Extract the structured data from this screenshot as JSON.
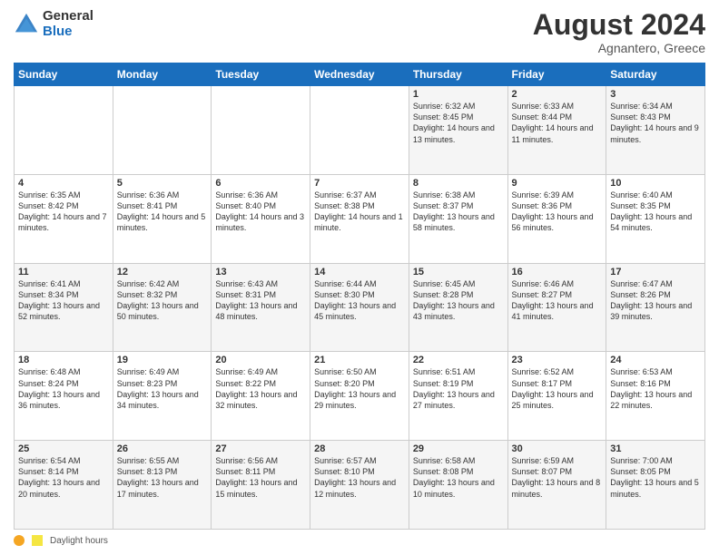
{
  "header": {
    "logo_general": "General",
    "logo_blue": "Blue",
    "month_title": "August 2024",
    "location": "Agnantero, Greece"
  },
  "calendar": {
    "days_of_week": [
      "Sunday",
      "Monday",
      "Tuesday",
      "Wednesday",
      "Thursday",
      "Friday",
      "Saturday"
    ],
    "weeks": [
      [
        {
          "day": "",
          "info": ""
        },
        {
          "day": "",
          "info": ""
        },
        {
          "day": "",
          "info": ""
        },
        {
          "day": "",
          "info": ""
        },
        {
          "day": "1",
          "info": "Sunrise: 6:32 AM\nSunset: 8:45 PM\nDaylight: 14 hours\nand 13 minutes."
        },
        {
          "day": "2",
          "info": "Sunrise: 6:33 AM\nSunset: 8:44 PM\nDaylight: 14 hours\nand 11 minutes."
        },
        {
          "day": "3",
          "info": "Sunrise: 6:34 AM\nSunset: 8:43 PM\nDaylight: 14 hours\nand 9 minutes."
        }
      ],
      [
        {
          "day": "4",
          "info": "Sunrise: 6:35 AM\nSunset: 8:42 PM\nDaylight: 14 hours\nand 7 minutes."
        },
        {
          "day": "5",
          "info": "Sunrise: 6:36 AM\nSunset: 8:41 PM\nDaylight: 14 hours\nand 5 minutes."
        },
        {
          "day": "6",
          "info": "Sunrise: 6:36 AM\nSunset: 8:40 PM\nDaylight: 14 hours\nand 3 minutes."
        },
        {
          "day": "7",
          "info": "Sunrise: 6:37 AM\nSunset: 8:38 PM\nDaylight: 14 hours\nand 1 minute."
        },
        {
          "day": "8",
          "info": "Sunrise: 6:38 AM\nSunset: 8:37 PM\nDaylight: 13 hours\nand 58 minutes."
        },
        {
          "day": "9",
          "info": "Sunrise: 6:39 AM\nSunset: 8:36 PM\nDaylight: 13 hours\nand 56 minutes."
        },
        {
          "day": "10",
          "info": "Sunrise: 6:40 AM\nSunset: 8:35 PM\nDaylight: 13 hours\nand 54 minutes."
        }
      ],
      [
        {
          "day": "11",
          "info": "Sunrise: 6:41 AM\nSunset: 8:34 PM\nDaylight: 13 hours\nand 52 minutes."
        },
        {
          "day": "12",
          "info": "Sunrise: 6:42 AM\nSunset: 8:32 PM\nDaylight: 13 hours\nand 50 minutes."
        },
        {
          "day": "13",
          "info": "Sunrise: 6:43 AM\nSunset: 8:31 PM\nDaylight: 13 hours\nand 48 minutes."
        },
        {
          "day": "14",
          "info": "Sunrise: 6:44 AM\nSunset: 8:30 PM\nDaylight: 13 hours\nand 45 minutes."
        },
        {
          "day": "15",
          "info": "Sunrise: 6:45 AM\nSunset: 8:28 PM\nDaylight: 13 hours\nand 43 minutes."
        },
        {
          "day": "16",
          "info": "Sunrise: 6:46 AM\nSunset: 8:27 PM\nDaylight: 13 hours\nand 41 minutes."
        },
        {
          "day": "17",
          "info": "Sunrise: 6:47 AM\nSunset: 8:26 PM\nDaylight: 13 hours\nand 39 minutes."
        }
      ],
      [
        {
          "day": "18",
          "info": "Sunrise: 6:48 AM\nSunset: 8:24 PM\nDaylight: 13 hours\nand 36 minutes."
        },
        {
          "day": "19",
          "info": "Sunrise: 6:49 AM\nSunset: 8:23 PM\nDaylight: 13 hours\nand 34 minutes."
        },
        {
          "day": "20",
          "info": "Sunrise: 6:49 AM\nSunset: 8:22 PM\nDaylight: 13 hours\nand 32 minutes."
        },
        {
          "day": "21",
          "info": "Sunrise: 6:50 AM\nSunset: 8:20 PM\nDaylight: 13 hours\nand 29 minutes."
        },
        {
          "day": "22",
          "info": "Sunrise: 6:51 AM\nSunset: 8:19 PM\nDaylight: 13 hours\nand 27 minutes."
        },
        {
          "day": "23",
          "info": "Sunrise: 6:52 AM\nSunset: 8:17 PM\nDaylight: 13 hours\nand 25 minutes."
        },
        {
          "day": "24",
          "info": "Sunrise: 6:53 AM\nSunset: 8:16 PM\nDaylight: 13 hours\nand 22 minutes."
        }
      ],
      [
        {
          "day": "25",
          "info": "Sunrise: 6:54 AM\nSunset: 8:14 PM\nDaylight: 13 hours\nand 20 minutes."
        },
        {
          "day": "26",
          "info": "Sunrise: 6:55 AM\nSunset: 8:13 PM\nDaylight: 13 hours\nand 17 minutes."
        },
        {
          "day": "27",
          "info": "Sunrise: 6:56 AM\nSunset: 8:11 PM\nDaylight: 13 hours\nand 15 minutes."
        },
        {
          "day": "28",
          "info": "Sunrise: 6:57 AM\nSunset: 8:10 PM\nDaylight: 13 hours\nand 12 minutes."
        },
        {
          "day": "29",
          "info": "Sunrise: 6:58 AM\nSunset: 8:08 PM\nDaylight: 13 hours\nand 10 minutes."
        },
        {
          "day": "30",
          "info": "Sunrise: 6:59 AM\nSunset: 8:07 PM\nDaylight: 13 hours\nand 8 minutes."
        },
        {
          "day": "31",
          "info": "Sunrise: 7:00 AM\nSunset: 8:05 PM\nDaylight: 13 hours\nand 5 minutes."
        }
      ]
    ]
  },
  "legend": {
    "daylight_label": "Daylight hours"
  }
}
